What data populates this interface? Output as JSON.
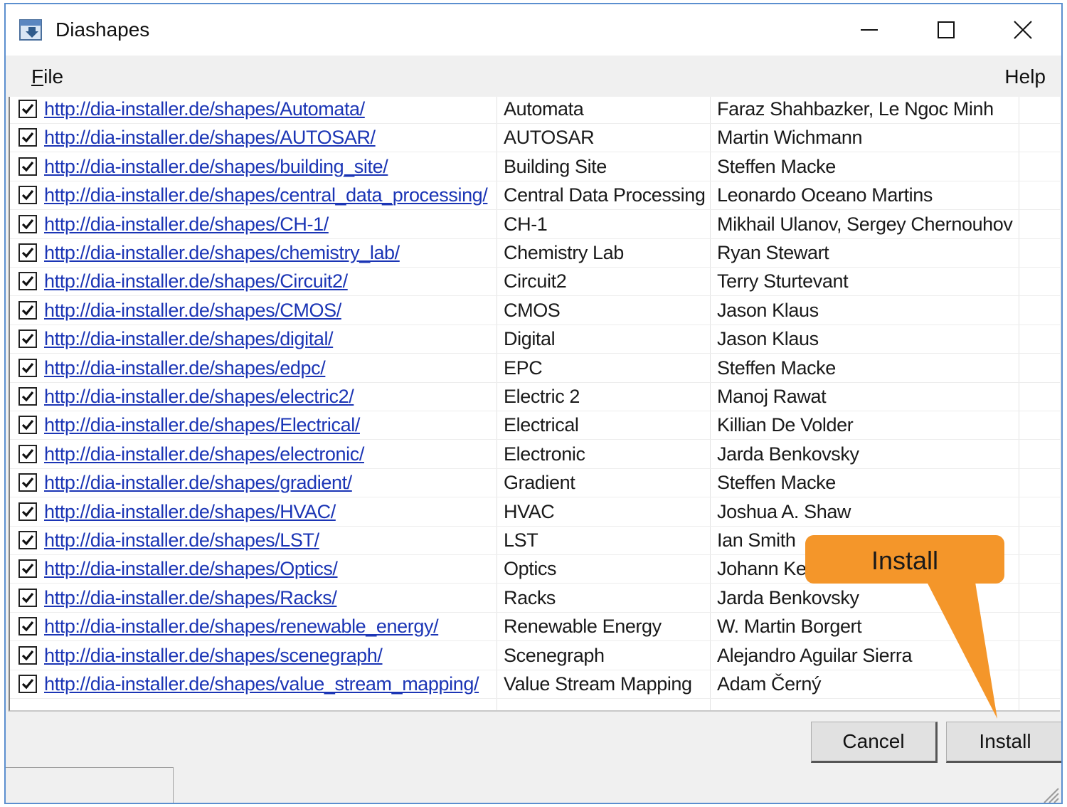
{
  "window": {
    "title": "Diashapes"
  },
  "menu": {
    "file": "File",
    "file_accel": "F",
    "file_rest": "ile",
    "help": "Help"
  },
  "rows": [
    {
      "checked": true,
      "url": "http://dia-installer.de/shapes/Automata/",
      "name": "Automata",
      "author": "Faraz Shahbazker, Le Ngoc Minh"
    },
    {
      "checked": true,
      "url": "http://dia-installer.de/shapes/AUTOSAR/",
      "name": "AUTOSAR",
      "author": "Martin Wichmann"
    },
    {
      "checked": true,
      "url": "http://dia-installer.de/shapes/building_site/",
      "name": "Building Site",
      "author": "Steffen Macke"
    },
    {
      "checked": true,
      "url": "http://dia-installer.de/shapes/central_data_processing/",
      "name": "Central Data Processing",
      "author": "Leonardo Oceano Martins"
    },
    {
      "checked": true,
      "url": "http://dia-installer.de/shapes/CH-1/",
      "name": "CH-1",
      "author": "Mikhail Ulanov, Sergey Chernouhov"
    },
    {
      "checked": true,
      "url": "http://dia-installer.de/shapes/chemistry_lab/",
      "name": "Chemistry Lab",
      "author": "Ryan Stewart"
    },
    {
      "checked": true,
      "url": "http://dia-installer.de/shapes/Circuit2/",
      "name": "Circuit2",
      "author": "Terry Sturtevant"
    },
    {
      "checked": true,
      "url": "http://dia-installer.de/shapes/CMOS/",
      "name": "CMOS",
      "author": "Jason Klaus"
    },
    {
      "checked": true,
      "url": "http://dia-installer.de/shapes/digital/",
      "name": "Digital",
      "author": "Jason Klaus"
    },
    {
      "checked": true,
      "url": "http://dia-installer.de/shapes/edpc/",
      "name": "EPC",
      "author": "Steffen Macke"
    },
    {
      "checked": true,
      "url": "http://dia-installer.de/shapes/electric2/",
      "name": "Electric 2",
      "author": "Manoj Rawat"
    },
    {
      "checked": true,
      "url": "http://dia-installer.de/shapes/Electrical/",
      "name": "Electrical",
      "author": "Killian De Volder"
    },
    {
      "checked": true,
      "url": "http://dia-installer.de/shapes/electronic/",
      "name": "Electronic",
      "author": "Jarda Benkovsky"
    },
    {
      "checked": true,
      "url": "http://dia-installer.de/shapes/gradient/",
      "name": "Gradient",
      "author": "Steffen Macke"
    },
    {
      "checked": true,
      "url": "http://dia-installer.de/shapes/HVAC/",
      "name": "HVAC",
      "author": "Joshua A. Shaw"
    },
    {
      "checked": true,
      "url": "http://dia-installer.de/shapes/LST/",
      "name": "LST",
      "author": "Ian Smith"
    },
    {
      "checked": true,
      "url": "http://dia-installer.de/shapes/Optics/",
      "name": "Optics",
      "author": "Johann Kell"
    },
    {
      "checked": true,
      "url": "http://dia-installer.de/shapes/Racks/",
      "name": "Racks",
      "author": "Jarda Benkovsky"
    },
    {
      "checked": true,
      "url": "http://dia-installer.de/shapes/renewable_energy/",
      "name": "Renewable Energy",
      "author": "W. Martin Borgert"
    },
    {
      "checked": true,
      "url": "http://dia-installer.de/shapes/scenegraph/",
      "name": "Scenegraph",
      "author": "Alejandro Aguilar Sierra"
    },
    {
      "checked": true,
      "url": "http://dia-installer.de/shapes/value_stream_mapping/",
      "name": "Value Stream Mapping",
      "author": "Adam Černý"
    }
  ],
  "buttons": {
    "cancel": "Cancel",
    "install": "Install"
  },
  "callout": {
    "text": "Install",
    "color": "#f4962a"
  },
  "colors": {
    "link": "#1b35b5",
    "window_border": "#5b8fcf"
  },
  "icons": {
    "app": "app-icon",
    "minimize": "minimize-icon",
    "maximize": "maximize-icon",
    "close": "close-icon",
    "check": "checkmark-icon",
    "grip": "resize-grip-icon"
  }
}
